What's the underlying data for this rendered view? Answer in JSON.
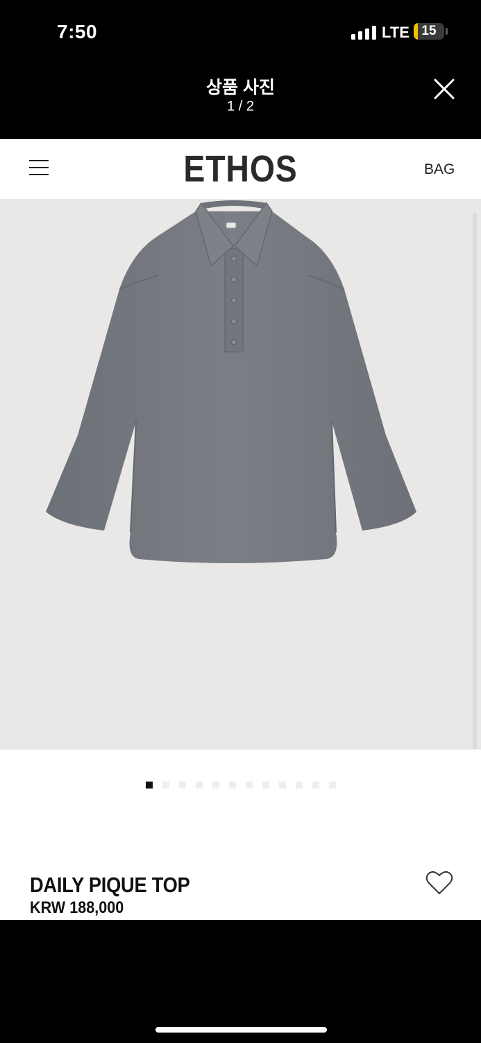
{
  "status_bar": {
    "time": "7:50",
    "network": "LTE",
    "battery": "15",
    "battery_color": "#f2c200"
  },
  "viewer": {
    "title": "상품 사진",
    "counter": "1 / 2",
    "close_icon": "close-x-icon"
  },
  "site": {
    "logo": "ETHOS",
    "menu_icon": "hamburger-menu-icon",
    "bag_label": "BAG"
  },
  "carousel": {
    "image_description_icon": "product-photo",
    "total_dots": 12,
    "active_index": 0
  },
  "product": {
    "name": "DAILY PIQUE TOP",
    "price": "KRW 188,000",
    "wishlist_icon": "heart-outline-icon"
  },
  "colors": {
    "garment": "#75787e",
    "image_bg": "#e9e8e7",
    "text": "#111111"
  }
}
